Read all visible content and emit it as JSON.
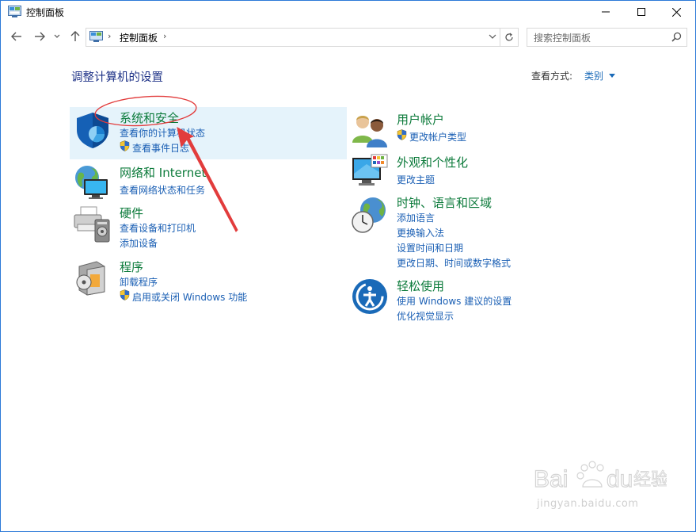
{
  "window": {
    "title": "控制面板"
  },
  "nav": {
    "breadcrumb": "控制面板",
    "search_placeholder": "搜索控制面板"
  },
  "header": {
    "title": "调整计算机的设置",
    "view_label": "查看方式:",
    "view_value": "类别"
  },
  "categories": [
    {
      "title": "系统和安全",
      "links": [
        "查看你的计算机状态",
        "查看事件日志"
      ]
    },
    {
      "title": "网络和 Internet",
      "links": [
        "查看网络状态和任务"
      ]
    },
    {
      "title": "硬件",
      "links": [
        "查看设备和打印机",
        "添加设备"
      ]
    },
    {
      "title": "程序",
      "links": [
        "卸载程序",
        "启用或关闭 Windows 功能"
      ]
    },
    {
      "title": "用户帐户",
      "links": [
        "更改帐户类型"
      ]
    },
    {
      "title": "外观和个性化",
      "links": [
        "更改主题"
      ]
    },
    {
      "title": "时钟、语言和区域",
      "links": [
        "添加语言",
        "更换输入法",
        "设置时间和日期",
        "更改日期、时间或数字格式"
      ]
    },
    {
      "title": "轻松使用",
      "links": [
        "使用 Windows 建议的设置",
        "优化视觉显示"
      ]
    }
  ],
  "watermark": {
    "text": "jingyan.baidu.com"
  },
  "colors": {
    "title_green": "#0b7a3a",
    "link_blue": "#1a5fb4",
    "annotation_red": "#e23c3c",
    "highlight": "#e5f3fb"
  }
}
